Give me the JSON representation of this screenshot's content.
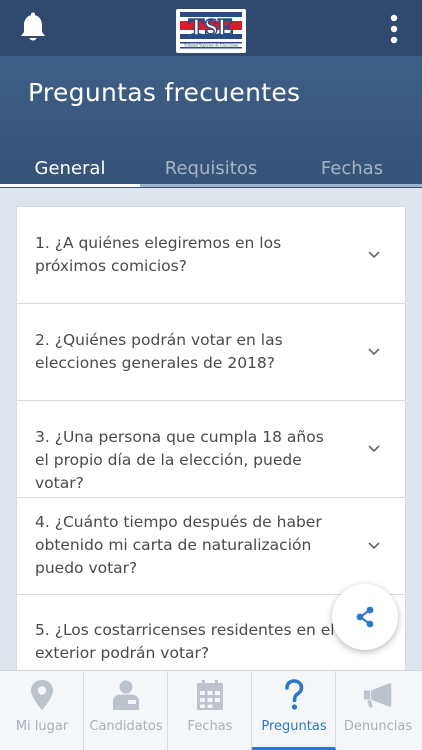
{
  "colors": {
    "header_bg": "#355277",
    "topbar_bg": "#2f4a6d",
    "accent": "#2a78c7",
    "inactive": "#a8b0bb"
  },
  "topbar": {
    "logo_text": "TSE",
    "logo_subtitle": "Tribunal Supremo de Elecciones",
    "icons": [
      "bell-icon",
      "more-vertical-icon"
    ]
  },
  "page": {
    "title": "Preguntas frecuentes"
  },
  "tabs": [
    {
      "label": "General",
      "active": true
    },
    {
      "label": "Requisitos",
      "active": false
    },
    {
      "label": "Fechas",
      "active": false
    }
  ],
  "faq": [
    {
      "question": "1. ¿A quiénes elegiremos en los próximos comicios?"
    },
    {
      "question": "2. ¿Quiénes podrán votar en las elecciones generales de 2018?"
    },
    {
      "question": "3. ¿Una persona que cumpla 18 años el propio día de la elección, puede votar?"
    },
    {
      "question": "4. ¿Cuánto tiempo después de haber obtenido mi carta de naturalización puedo votar?"
    },
    {
      "question": "5. ¿Los costarricenses residentes en el exterior podrán votar?"
    }
  ],
  "fab": {
    "icon": "share-icon"
  },
  "bottom_nav": [
    {
      "label": "Mi lugar",
      "icon": "location-pin-icon",
      "active": false
    },
    {
      "label": "Candidatos",
      "icon": "candidate-icon",
      "active": false
    },
    {
      "label": "Fechas",
      "icon": "calendar-icon",
      "active": false
    },
    {
      "label": "Preguntas",
      "icon": "question-icon",
      "active": true
    },
    {
      "label": "Denuncias",
      "icon": "megaphone-icon",
      "active": false
    }
  ]
}
